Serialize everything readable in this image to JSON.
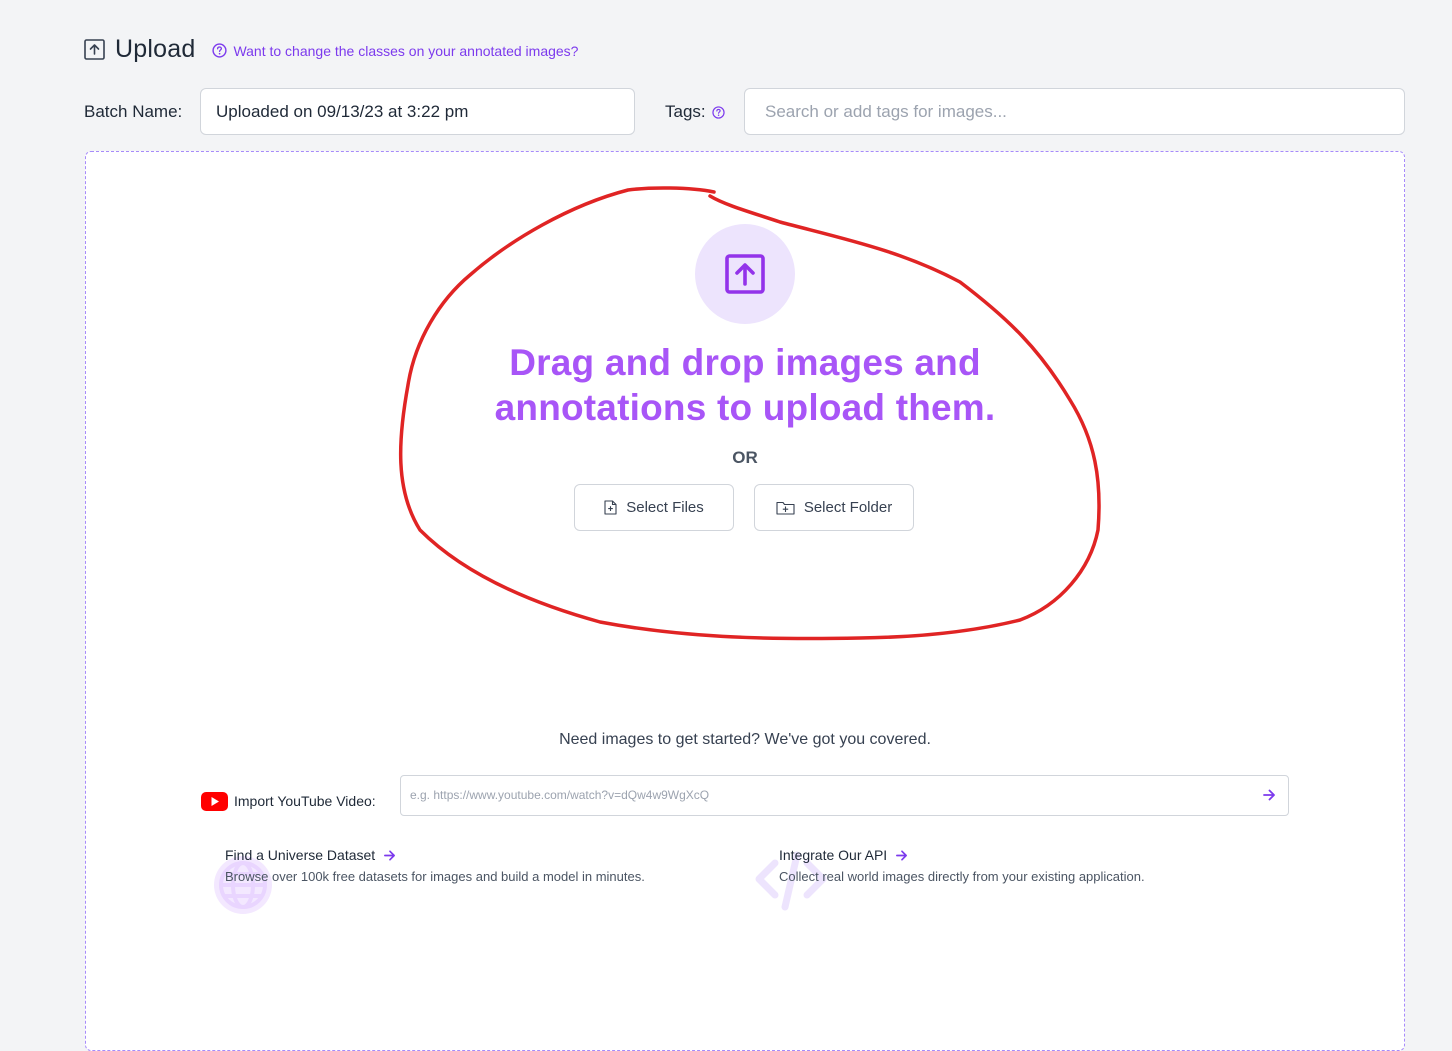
{
  "header": {
    "title": "Upload",
    "help_link": "Want to change the classes on your annotated images?"
  },
  "batch": {
    "label": "Batch Name:",
    "value": "Uploaded on 09/13/23 at 3:22 pm"
  },
  "tags": {
    "label": "Tags:",
    "placeholder": "Search or add tags for images..."
  },
  "dropzone": {
    "headline_line1": "Drag and drop images and",
    "headline_line2": "annotations to upload them.",
    "or": "OR",
    "select_files": "Select Files",
    "select_folder": "Select Folder"
  },
  "getting_started": {
    "text": "Need images to get started? We've got you covered.",
    "youtube_label": "Import YouTube Video:",
    "youtube_placeholder": "e.g. https://www.youtube.com/watch?v=dQw4w9WgXcQ"
  },
  "features": [
    {
      "title": "Find a Universe Dataset",
      "description": "Browse over 100k free datasets for images and build a model in minutes.",
      "icon": "globe-icon"
    },
    {
      "title": "Integrate Our API",
      "description": "Collect real world images directly from your existing application.",
      "icon": "code-icon"
    }
  ],
  "colors": {
    "accent": "#7c3aed",
    "headline": "#a855f7",
    "circle_bg": "#ede4fd",
    "annotation": "#e02424",
    "youtube": "#ff0000"
  }
}
